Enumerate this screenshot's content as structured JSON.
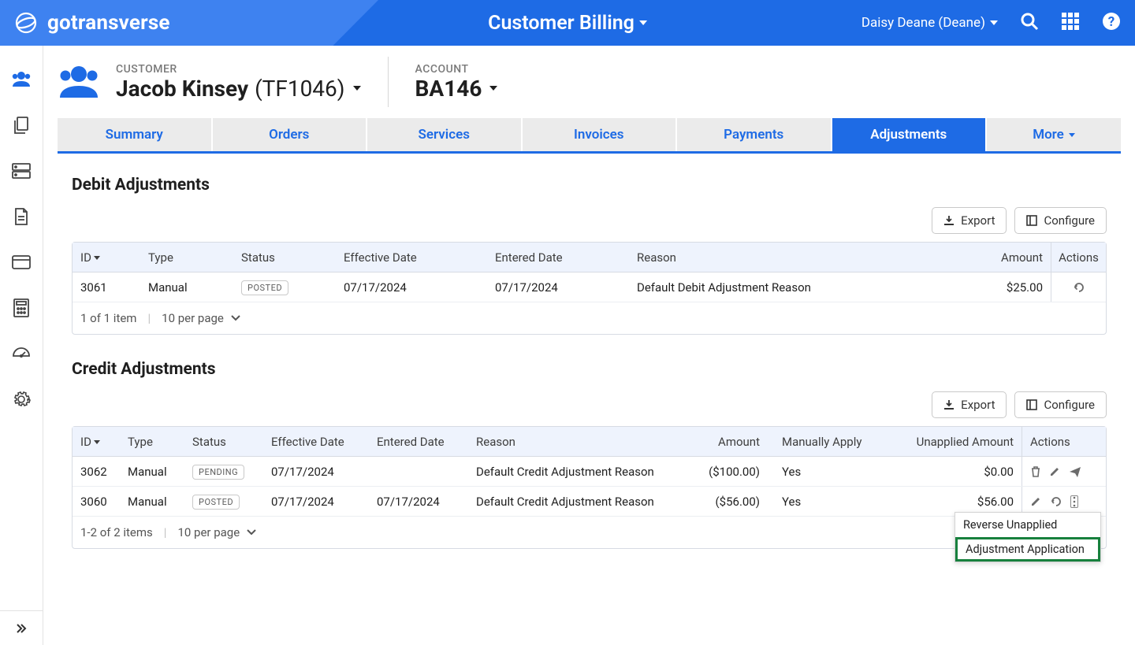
{
  "brand": "gotransverse",
  "page_title": "Customer Billing",
  "user": {
    "display": "Daisy Deane (Deane)"
  },
  "header": {
    "customer_label": "CUSTOMER",
    "customer_name": "Jacob Kinsey",
    "customer_code": "(TF1046)",
    "account_label": "ACCOUNT",
    "account_id": "BA146"
  },
  "tabs": {
    "summary": "Summary",
    "orders": "Orders",
    "services": "Services",
    "invoices": "Invoices",
    "payments": "Payments",
    "adjustments": "Adjustments",
    "more": "More"
  },
  "buttons": {
    "export": "Export",
    "configure": "Configure"
  },
  "debit": {
    "title": "Debit Adjustments",
    "cols": {
      "id": "ID",
      "type": "Type",
      "status": "Status",
      "eff": "Effective Date",
      "ent": "Entered Date",
      "reason": "Reason",
      "amount": "Amount",
      "actions": "Actions"
    },
    "rows": [
      {
        "id": "3061",
        "type": "Manual",
        "status": "POSTED",
        "eff": "07/17/2024",
        "ent": "07/17/2024",
        "reason": "Default Debit Adjustment Reason",
        "amount": "$25.00"
      }
    ],
    "footer": {
      "count": "1 of 1 item",
      "per_page": "10 per page"
    }
  },
  "credit": {
    "title": "Credit Adjustments",
    "cols": {
      "id": "ID",
      "type": "Type",
      "status": "Status",
      "eff": "Effective Date",
      "ent": "Entered Date",
      "reason": "Reason",
      "amount": "Amount",
      "man": "Manually Apply",
      "unap": "Unapplied Amount",
      "actions": "Actions"
    },
    "rows": [
      {
        "id": "3062",
        "type": "Manual",
        "status": "PENDING",
        "eff": "07/17/2024",
        "ent": "",
        "reason": "Default Credit Adjustment Reason",
        "amount": "($100.00)",
        "man": "Yes",
        "unap": "$0.00",
        "icons": [
          "trash",
          "pencil",
          "send"
        ]
      },
      {
        "id": "3060",
        "type": "Manual",
        "status": "POSTED",
        "eff": "07/17/2024",
        "ent": "07/17/2024",
        "reason": "Default Credit Adjustment Reason",
        "amount": "($56.00)",
        "man": "Yes",
        "unap": "$56.00",
        "icons": [
          "pencil",
          "undo",
          "more"
        ]
      }
    ],
    "footer": {
      "count": "1-2 of 2 items",
      "per_page": "10 per page"
    },
    "menu": {
      "reverse": "Reverse Unapplied",
      "application": "Adjustment Application"
    }
  }
}
